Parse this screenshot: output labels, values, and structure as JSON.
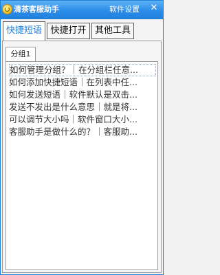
{
  "titlebar": {
    "app_name": "清茶客服助手",
    "settings_label": "软件设置",
    "close_glyph": "✕",
    "logo_icon": "app-logo-icon"
  },
  "tabs": [
    {
      "label": "快捷短语",
      "active": true
    },
    {
      "label": "快捷打开",
      "active": false
    },
    {
      "label": "其他工具",
      "active": false
    }
  ],
  "group_tab": {
    "label": "分组1"
  },
  "phrases": [
    "如何管理分组？｜在分组栏任意...",
    "如何添加快捷短语｜在列表中任...",
    "如何发送短语｜软件默认是双击...",
    "发送不发出是什么意思｜就是将...",
    "可以调节大小吗｜软件窗口大小...",
    "客服助手是做什么的？｜客服助..."
  ],
  "colors": {
    "titlebar": "#2a8ce8",
    "active_tab_text": "#1c78d8",
    "window_border": "#1d7fd8"
  }
}
